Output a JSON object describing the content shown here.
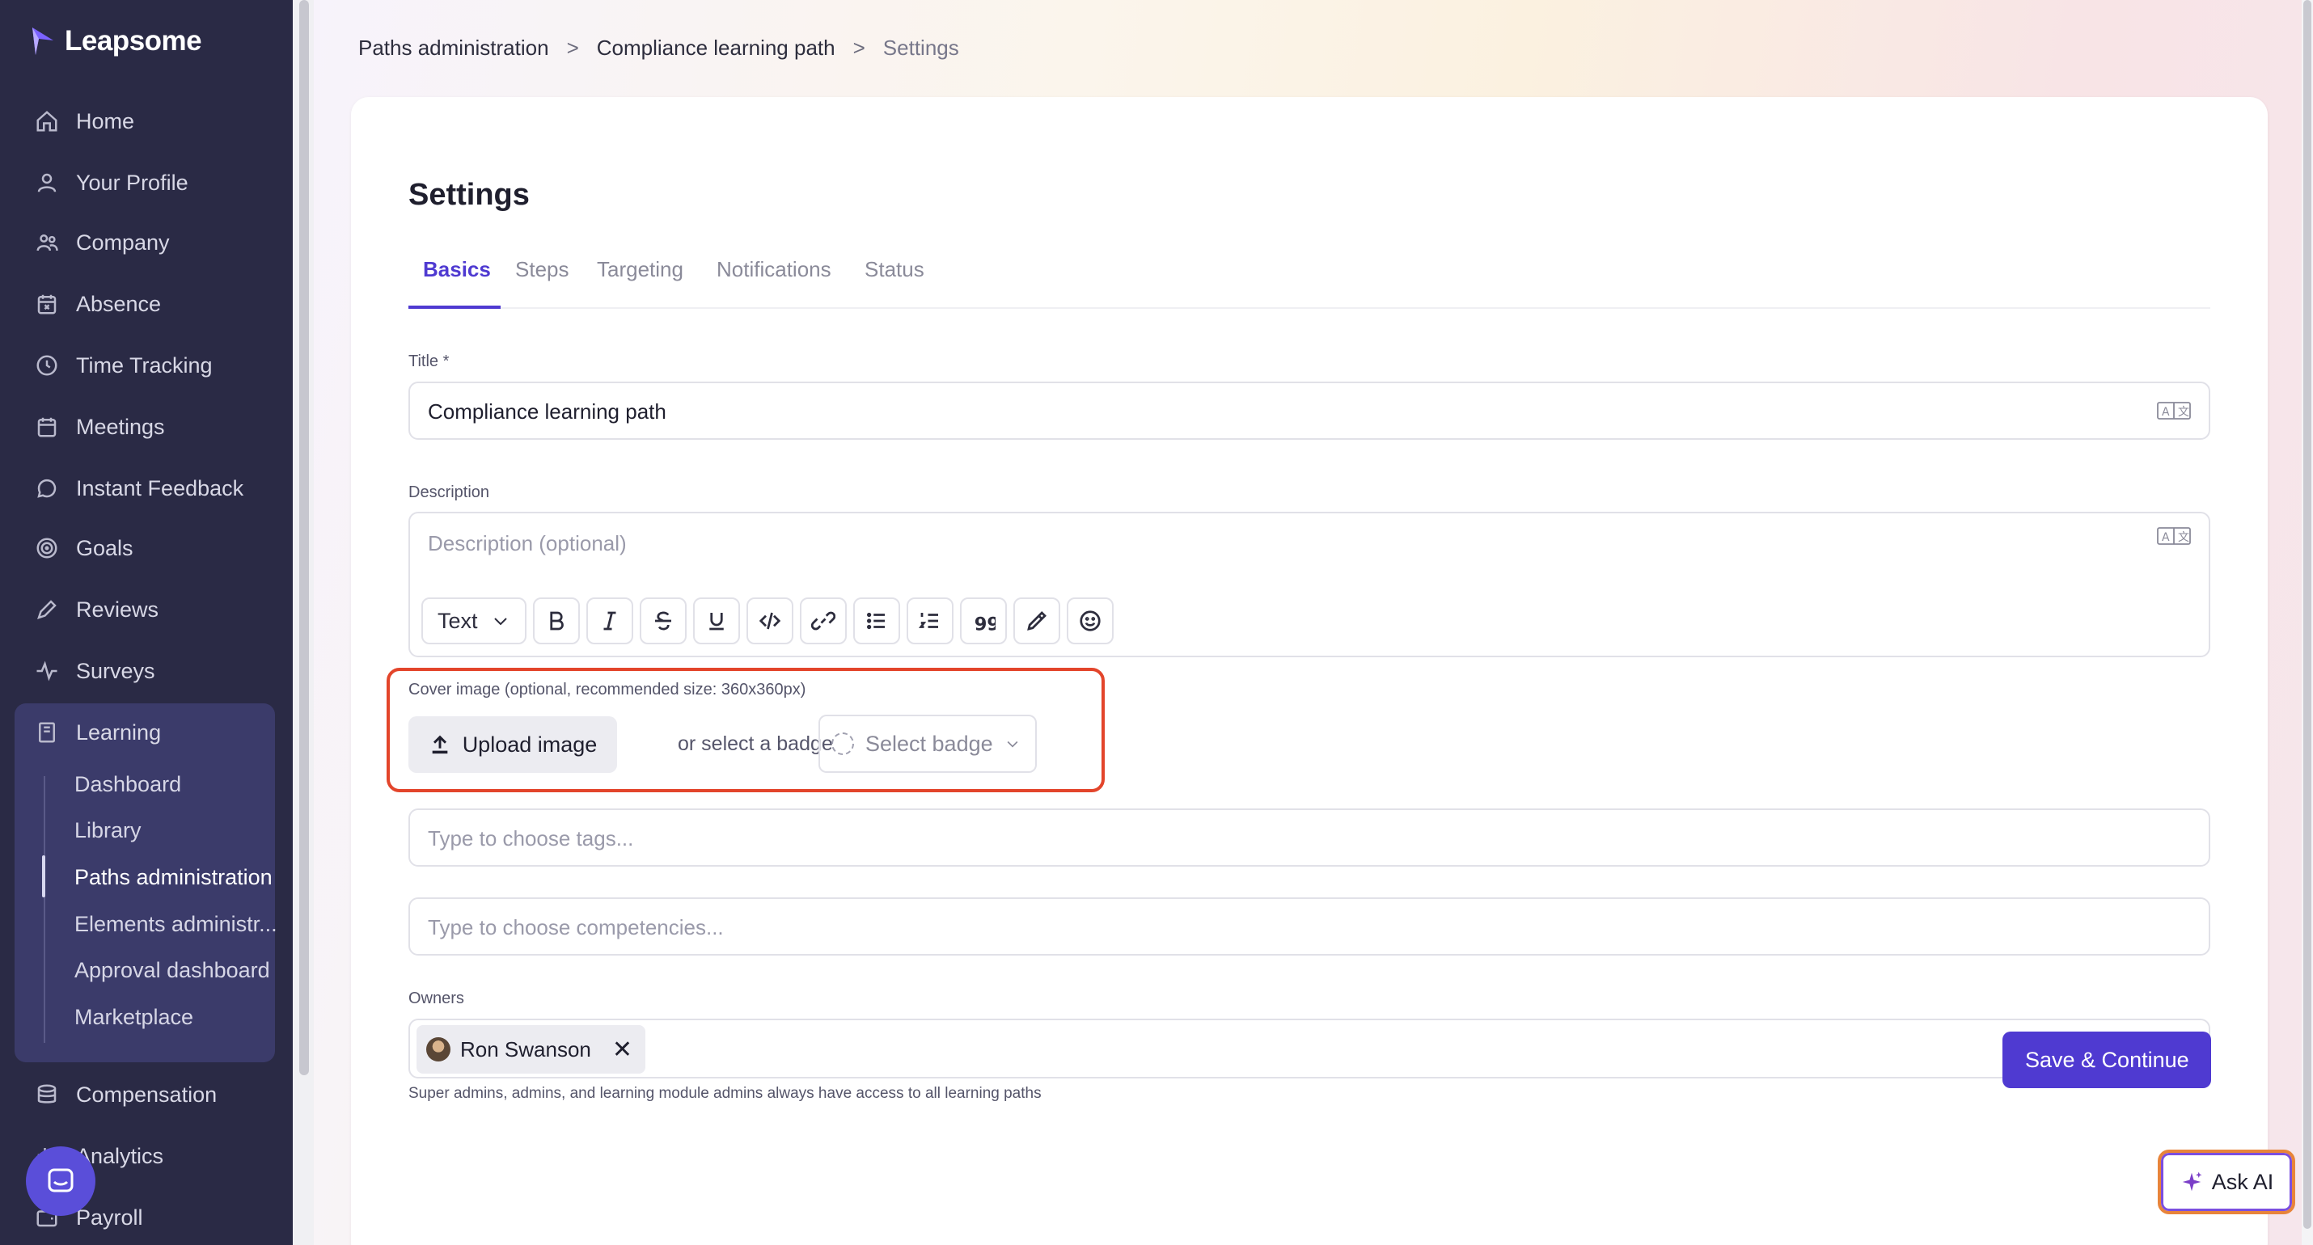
{
  "brand": {
    "name": "Leapsome"
  },
  "sidebar": {
    "items": [
      {
        "label": "Home",
        "icon": "home-icon"
      },
      {
        "label": "Your Profile",
        "icon": "user-icon"
      },
      {
        "label": "Company",
        "icon": "users-icon"
      },
      {
        "label": "Absence",
        "icon": "calendar-x-icon"
      },
      {
        "label": "Time Tracking",
        "icon": "clock-icon"
      },
      {
        "label": "Meetings",
        "icon": "calendar-icon"
      },
      {
        "label": "Instant Feedback",
        "icon": "chat-icon"
      },
      {
        "label": "Goals",
        "icon": "target-icon"
      },
      {
        "label": "Reviews",
        "icon": "pen-icon"
      },
      {
        "label": "Surveys",
        "icon": "pulse-icon"
      },
      {
        "label": "Learning",
        "icon": "book-icon"
      },
      {
        "label": "Compensation",
        "icon": "coins-icon"
      },
      {
        "label": "Analytics",
        "icon": "chart-icon"
      },
      {
        "label": "Payroll",
        "icon": "wallet-icon"
      }
    ],
    "learning_sub": [
      {
        "label": "Dashboard"
      },
      {
        "label": "Library"
      },
      {
        "label": "Paths administration"
      },
      {
        "label": "Elements administr..."
      },
      {
        "label": "Approval dashboard"
      },
      {
        "label": "Marketplace"
      }
    ]
  },
  "breadcrumb": {
    "items": [
      "Paths administration",
      "Compliance learning path"
    ],
    "current": "Settings",
    "separator": ">"
  },
  "page": {
    "title": "Settings",
    "tabs": [
      "Basics",
      "Steps",
      "Targeting",
      "Notifications",
      "Status"
    ],
    "active_tab": "Basics"
  },
  "form": {
    "title_label": "Title *",
    "title_value": "Compliance learning path",
    "description_label": "Description",
    "description_placeholder": "Description (optional)",
    "toolbar": {
      "text_style": "Text"
    },
    "cover_label": "Cover image (optional, recommended size: 360x360px)",
    "upload_label": "Upload image",
    "or_select": "or select a badge",
    "select_badge": "Select badge",
    "tags_placeholder": "Type to choose tags...",
    "competencies_placeholder": "Type to choose competencies...",
    "owners_label": "Owners",
    "owner_name": "Ron Swanson",
    "owners_helper": "Super admins, admins, and learning module admins always have access to all learning paths",
    "save_label": "Save & Continue"
  },
  "ask_ai": {
    "label": "Ask AI"
  },
  "colors": {
    "accent": "#4f3ad1",
    "sidebar": "#2a2a45",
    "highlight": "#e3452b"
  }
}
